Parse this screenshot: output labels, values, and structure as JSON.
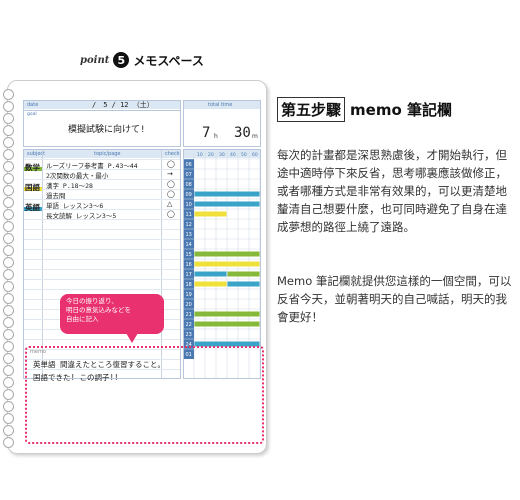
{
  "heading": {
    "point_label": "point",
    "point_number": "5",
    "title": "メモスペース"
  },
  "planner": {
    "date_label": "date",
    "date_value": "/　5 / 12 （土）",
    "goal_label": "goal",
    "goal_text": "模擬試験に向けて!",
    "total_label": "total time",
    "total_hours": "7",
    "total_h_unit": "h",
    "total_minutes": "30",
    "total_m_unit": "m",
    "columns": {
      "subject": "subject",
      "topic": "topic/page",
      "check": "check"
    },
    "subjects": [
      {
        "name": "数学",
        "color": "#86b83a",
        "lines": [
          "ルーズリーフ参考書 P.43～44",
          "2次関数の最大・最小"
        ],
        "checks": [
          "◯",
          "→"
        ]
      },
      {
        "name": "国語",
        "color": "#f0e03a",
        "lines": [
          "漢字 P.18～28",
          "過去問"
        ],
        "checks": [
          "◯",
          "◯"
        ]
      },
      {
        "name": "英語",
        "color": "#3aa3c8",
        "lines": [
          "単語 レッスン3～6",
          "長文読解 レッスン3～5"
        ],
        "checks": [
          "△",
          "◯"
        ]
      }
    ],
    "time_minutes": [
      "10",
      "20",
      "30",
      "40",
      "50",
      "60"
    ],
    "hours": [
      "06",
      "07",
      "08",
      "09",
      "10",
      "11",
      "12",
      "13",
      "14",
      "15",
      "16",
      "17",
      "18",
      "19",
      "20",
      "21",
      "22",
      "23",
      "24",
      "01"
    ],
    "callout": [
      "今日の振り返り、",
      "明日の意気込みなどを",
      "自由に記入"
    ],
    "memo_label": "memo",
    "memo_lines": [
      "英単語 間違えたところ復習すること。",
      "国語できた! この調子!!"
    ]
  },
  "article": {
    "title_boxed": "第五步驟",
    "title_rest": "memo 筆記欄",
    "paragraph1": "每次的計畫都是深思熟慮後，才開始執行，但途中適時停下來反省，思考哪裏應該做修正，或者哪種方式是非常有效果的，可以更清楚地釐清自己想要什麼，也可同時避免了自身在達成夢想的路徑上繞了遠路。",
    "paragraph2": "Memo 筆記欄就提供您這樣的一個空間，可以反省今天，並朝著明天的自己喊話，明天的我會更好！"
  },
  "colors": {
    "accent_pink": "#e8316e",
    "math_green": "#86b83a",
    "japanese_yellow": "#f0e03a",
    "english_blue": "#3aa3c8"
  }
}
